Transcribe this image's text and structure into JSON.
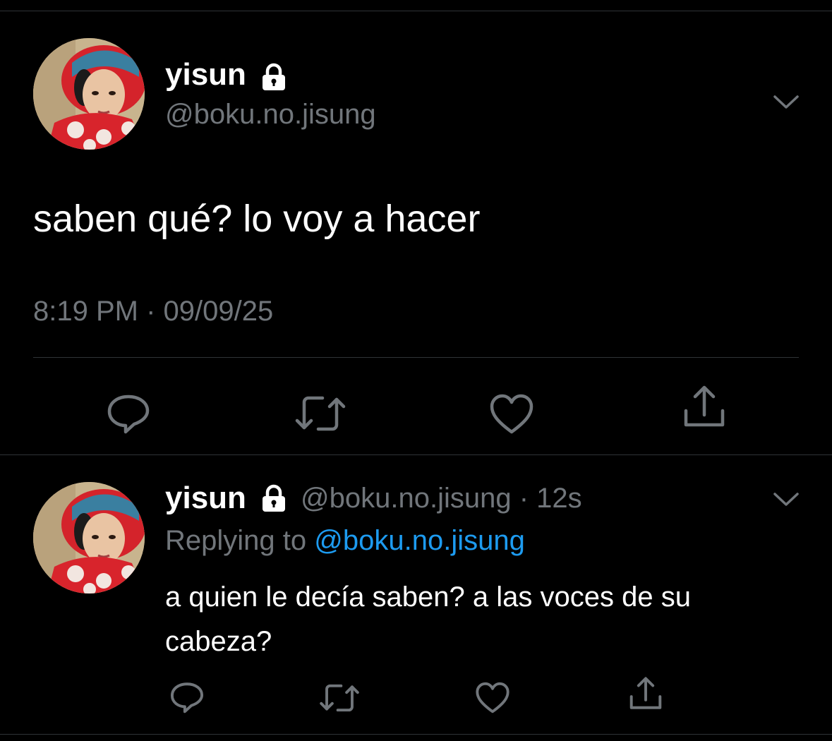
{
  "colors": {
    "background": "#000000",
    "text_primary": "#ffffff",
    "text_secondary": "#71767b",
    "link": "#1d9bf0",
    "divider": "#2f3336",
    "icon": "#71767b"
  },
  "main_tweet": {
    "avatar": "profile-photo",
    "display_name": "yisun",
    "protected_icon": "lock-icon",
    "handle": "@boku.no.jisung",
    "menu_icon": "chevron-down-icon",
    "text": "saben qué? lo voy a hacer",
    "timestamp": "8:19 PM · 09/09/25",
    "actions": {
      "reply_icon": "reply-icon",
      "retweet_icon": "retweet-icon",
      "like_icon": "heart-icon",
      "share_icon": "share-icon"
    }
  },
  "reply_tweet": {
    "avatar": "profile-photo",
    "display_name": "yisun",
    "protected_icon": "lock-icon",
    "handle": "@boku.no.jisung",
    "separator": " · ",
    "time_ago": "12s",
    "menu_icon": "chevron-down-icon",
    "replying_to_label": "Replying to",
    "replying_to_handle": "@boku.no.jisung",
    "text": "a quien le decía saben? a las voces de su cabeza?",
    "actions": {
      "reply_icon": "reply-icon",
      "retweet_icon": "retweet-icon",
      "like_icon": "heart-icon",
      "share_icon": "share-icon"
    }
  }
}
